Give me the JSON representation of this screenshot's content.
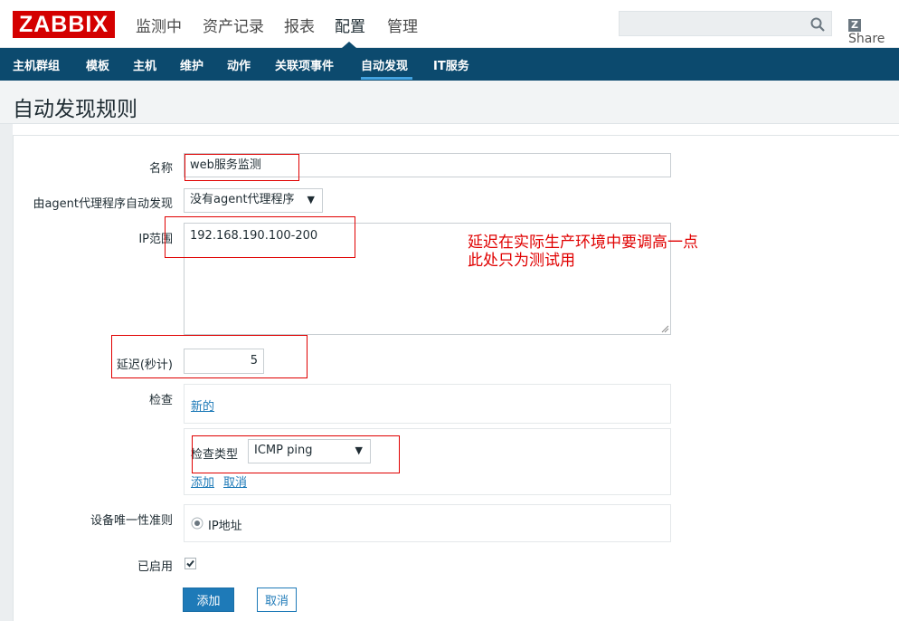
{
  "top": {
    "logo": "ZABBIX",
    "menu": [
      "监测中",
      "资产记录",
      "报表",
      "配置",
      "管理"
    ],
    "share": "Share",
    "share_badge": "Z"
  },
  "subnav": [
    "主机群组",
    "模板",
    "主机",
    "维护",
    "动作",
    "关联项事件",
    "自动发现",
    "IT服务"
  ],
  "page_title": "自动发现规则",
  "form": {
    "name_label": "名称",
    "name_value": "web服务监测",
    "proxy_label": "由agent代理程序自动发现",
    "proxy_value": "没有agent代理程序",
    "ip_label": "IP范围",
    "ip_value": "192.168.190.100-200",
    "delay_label": "延迟(秒计)",
    "delay_value": "5",
    "checks_label": "检查",
    "new_link": "新的",
    "check_type_label": "检查类型",
    "check_type_value": "ICMP ping",
    "add_link": "添加",
    "cancel_link": "取消",
    "uniqueness_label": "设备唯一性准则",
    "uniqueness_option": "IP地址",
    "enabled_label": "已启用",
    "add_button": "添加",
    "cancel_button": "取消"
  },
  "annotation": {
    "line1": "延迟在实际生产环境中要调高一点",
    "line2": "此处只为测试用"
  },
  "colors": {
    "brand_red": "#d40000",
    "nav_blue": "#0c4a6e",
    "accent_blue": "#1e7ab8",
    "annotation_red": "#e00000"
  }
}
